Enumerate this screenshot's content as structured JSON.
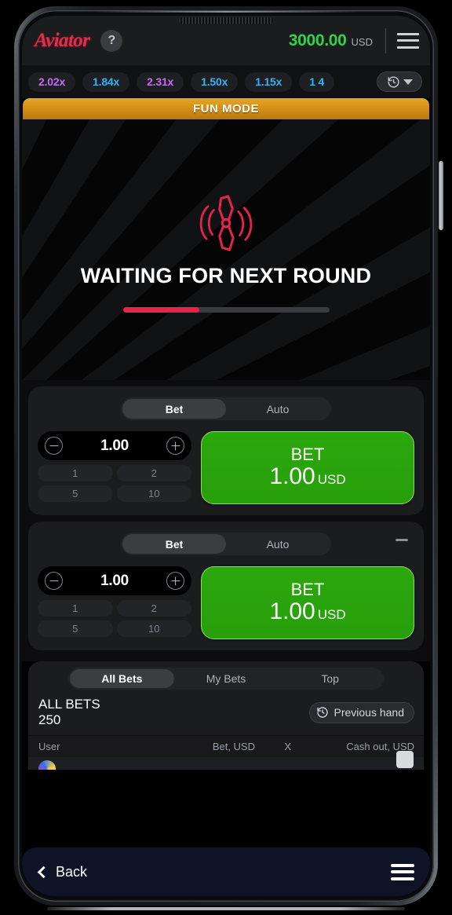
{
  "header": {
    "logo": "Aviator",
    "help_icon": "question-mark-icon",
    "balance": "3000.00",
    "currency": "USD",
    "menu_icon": "hamburger-menu-icon"
  },
  "history": {
    "items": [
      {
        "value": "2.02x",
        "color": "#c56bf5"
      },
      {
        "value": "1.84x",
        "color": "#34b3f1"
      },
      {
        "value": "2.31x",
        "color": "#c56bf5"
      },
      {
        "value": "1.50x",
        "color": "#34b3f1"
      },
      {
        "value": "1.15x",
        "color": "#34b3f1"
      },
      {
        "value": "1 4",
        "color": "#34b3f1"
      }
    ],
    "toggle_icon": "clock-history-icon",
    "caret_icon": "chevron-down-icon"
  },
  "game": {
    "banner": "FUN MODE",
    "propeller_icon": "propeller-icon",
    "status": "WAITING FOR NEXT ROUND",
    "progress_percent": 37,
    "progress_color": "#e7224d"
  },
  "bet_panels": [
    {
      "tab_bet": "Bet",
      "tab_auto": "Auto",
      "active_tab": "Bet",
      "amount": "1.00",
      "minus_icon": "minus-circle-icon",
      "plus_icon": "plus-circle-icon",
      "quick_amounts": [
        "1",
        "2",
        "5",
        "10"
      ],
      "button_title": "BET",
      "button_amount": "1.00",
      "button_currency": "USD",
      "button_color": "#28a30b",
      "has_remove": false
    },
    {
      "tab_bet": "Bet",
      "tab_auto": "Auto",
      "active_tab": "Bet",
      "amount": "1.00",
      "minus_icon": "minus-circle-icon",
      "plus_icon": "plus-circle-icon",
      "quick_amounts": [
        "1",
        "2",
        "5",
        "10"
      ],
      "button_title": "BET",
      "button_amount": "1.00",
      "button_currency": "USD",
      "button_color": "#28a30b",
      "has_remove": true,
      "remove_icon": "minus-icon"
    }
  ],
  "bets_section": {
    "tabs": [
      "All Bets",
      "My Bets",
      "Top"
    ],
    "active_tab": "All Bets",
    "title": "ALL BETS",
    "count": "250",
    "previous_hand": "Previous hand",
    "previous_hand_icon": "clock-history-icon",
    "columns": {
      "user": "User",
      "bet": "Bet, USD",
      "x": "X",
      "cashout": "Cash out, USD"
    }
  },
  "bottom_nav": {
    "back_label": "Back",
    "back_icon": "chevron-left-icon",
    "menu_icon": "hamburger-menu-icon"
  }
}
